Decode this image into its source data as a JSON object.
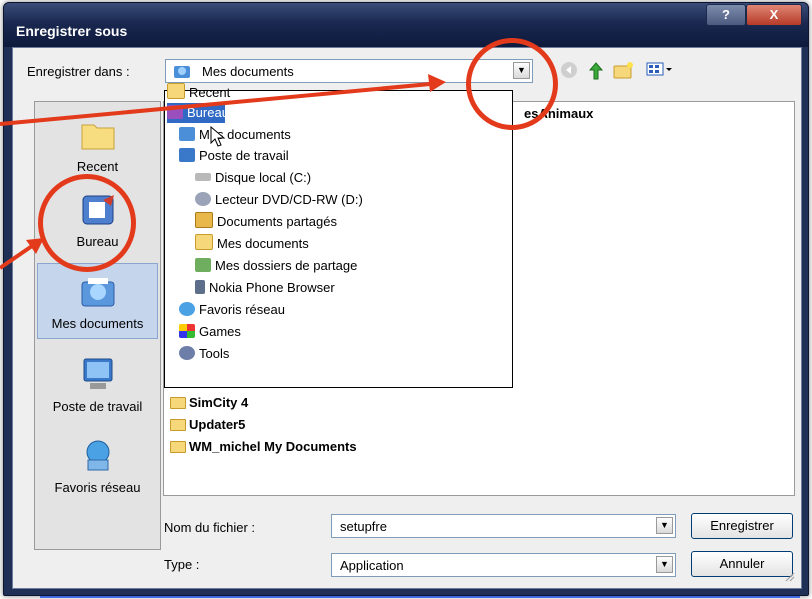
{
  "window": {
    "title": "Enregistrer sous",
    "help_label": "?",
    "close_label": "X"
  },
  "toolbar": {
    "save_in_label": "Enregistrer dans :",
    "save_in_value": "Mes documents",
    "back_icon": "back-icon",
    "up_icon": "up-folder-icon",
    "new_folder_icon": "new-folder-icon",
    "views_icon": "views-menu-icon"
  },
  "places": [
    {
      "label": "Recent",
      "icon": "recent-folder-icon"
    },
    {
      "label": "Bureau",
      "icon": "desktop-icon"
    },
    {
      "label": "Mes documents",
      "icon": "my-documents-icon"
    },
    {
      "label": "Poste de travail",
      "icon": "my-computer-icon"
    },
    {
      "label": "Favoris réseau",
      "icon": "network-places-icon"
    }
  ],
  "files": [
    {
      "name": "esAnimaux"
    },
    {
      "name": "SimCity 4"
    },
    {
      "name": "Updater5"
    },
    {
      "name": "WM_michel My Documents"
    }
  ],
  "dropdown": [
    {
      "label": "Recent",
      "indent": 0,
      "icon": "folder-icon"
    },
    {
      "label": "Bureau",
      "indent": 0,
      "icon": "desktop-icon"
    },
    {
      "label": "Mes documents",
      "indent": 1,
      "icon": "my-documents-icon"
    },
    {
      "label": "Poste de travail",
      "indent": 1,
      "icon": "my-computer-icon"
    },
    {
      "label": "Disque local (C:)",
      "indent": 2,
      "icon": "hard-disk-icon"
    },
    {
      "label": "Lecteur DVD/CD-RW (D:)",
      "indent": 2,
      "icon": "dvd-drive-icon"
    },
    {
      "label": "Documents partagés",
      "indent": 2,
      "icon": "shared-folder-icon"
    },
    {
      "label": "Mes documents",
      "indent": 2,
      "icon": "folder-icon"
    },
    {
      "label": "Mes dossiers de partage",
      "indent": 2,
      "icon": "share-folder-icon"
    },
    {
      "label": "Nokia Phone Browser",
      "indent": 2,
      "icon": "phone-icon"
    },
    {
      "label": "Favoris réseau",
      "indent": 1,
      "icon": "network-places-icon"
    },
    {
      "label": "Games",
      "indent": 1,
      "icon": "games-icon"
    },
    {
      "label": "Tools",
      "indent": 1,
      "icon": "tools-icon"
    }
  ],
  "filename": {
    "label": "Nom du fichier :",
    "value": "setupfre"
  },
  "filetype": {
    "label": "Type :",
    "value": "Application"
  },
  "buttons": {
    "save": "Enregistrer",
    "cancel": "Annuler"
  },
  "colors": {
    "highlight": "#316ac5",
    "annotation": "#e33a1c",
    "selected_place": "#c5d5ec"
  }
}
